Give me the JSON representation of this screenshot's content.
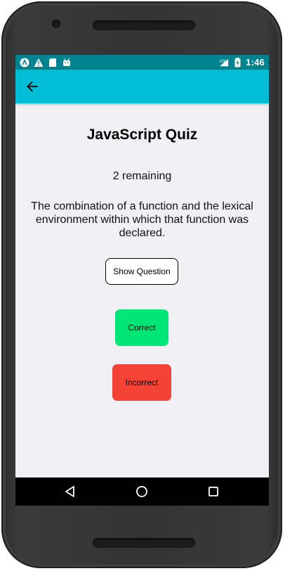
{
  "status_bar": {
    "time": "1:46",
    "left_icons": [
      "aperture-icon",
      "warning-icon",
      "sd-card-icon",
      "android-icon"
    ],
    "right_icons": [
      "signal-icon",
      "battery-charging-icon"
    ],
    "background_color": "#00838f"
  },
  "app_bar": {
    "back_icon": "arrow-left-icon",
    "background_color": "#00bcd4"
  },
  "quiz": {
    "title": "JavaScript Quiz",
    "remaining": "2 remaining",
    "question": "The combination of a function and the lexical environment within which that function was declared.",
    "show_question_label": "Show Question",
    "correct_label": "Correct",
    "incorrect_label": "Incorrect",
    "correct_color": "#00e676",
    "incorrect_color": "#f44336"
  },
  "nav_bar": {
    "icons": [
      "back-triangle-icon",
      "home-circle-icon",
      "recents-square-icon"
    ]
  }
}
